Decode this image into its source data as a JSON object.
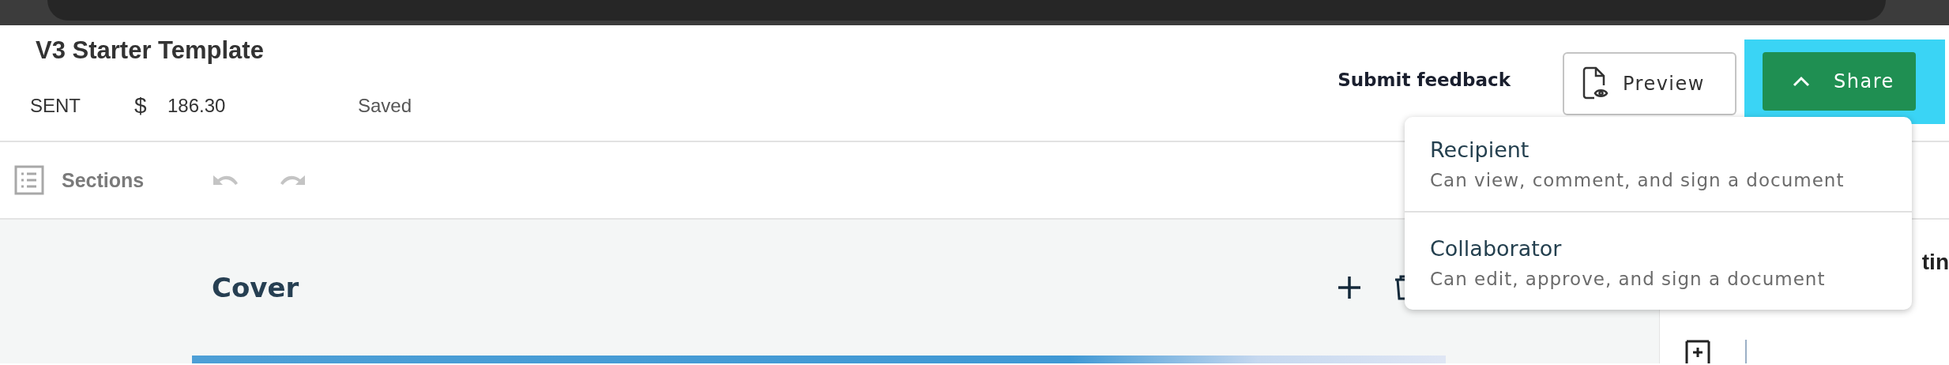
{
  "header": {
    "title": "V3 Starter Template",
    "status": "SENT",
    "currency": "$",
    "amount": "186.30",
    "save_state": "Saved"
  },
  "actions": {
    "feedback_link": "Submit feedback",
    "preview_button": "Preview",
    "share_button": {
      "label": "Share",
      "expanded": true,
      "highlighted": true
    }
  },
  "share_menu": [
    {
      "title": "Recipient",
      "description": "Can view, comment, and sign a document"
    },
    {
      "title": "Collaborator",
      "description": "Can edit, approve, and sign a document"
    }
  ],
  "toolbar": {
    "sections_button": "Sections"
  },
  "section": {
    "title": "Cover"
  },
  "side_panel": {
    "heading_fragment": "tin"
  }
}
